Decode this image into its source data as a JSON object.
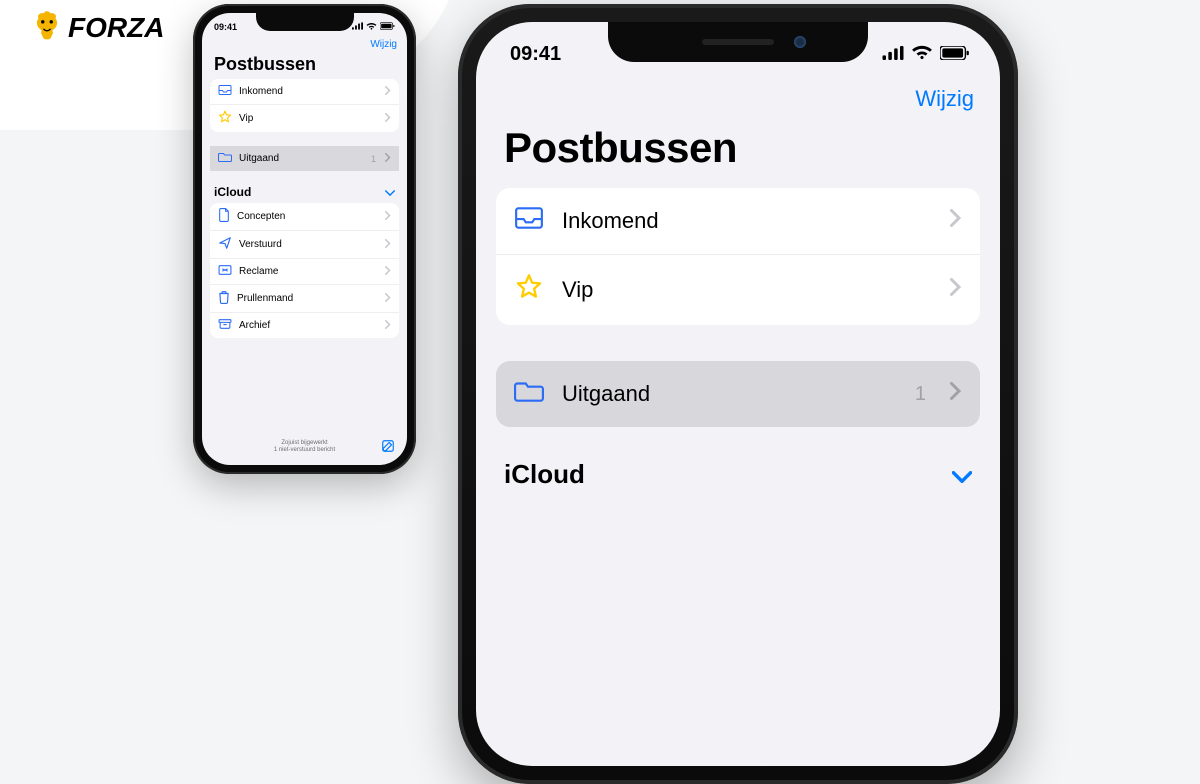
{
  "brand": {
    "name": "FORZA"
  },
  "statusbar": {
    "time": "09:41"
  },
  "nav": {
    "edit": "Wijzig"
  },
  "title": "Postbussen",
  "mailboxes": {
    "inbox": {
      "label": "Inkomend"
    },
    "vip": {
      "label": "Vip"
    }
  },
  "outbox": {
    "label": "Uitgaand",
    "count": "1"
  },
  "account": {
    "name": "iCloud"
  },
  "account_folders": {
    "drafts": {
      "label": "Concepten"
    },
    "sent": {
      "label": "Verstuurd"
    },
    "junk": {
      "label": "Reclame"
    },
    "trash": {
      "label": "Prullenmand"
    },
    "archive": {
      "label": "Archief"
    }
  },
  "footer": {
    "line1": "Zojuist bijgewerkt",
    "line2": "1 niet-verstuurd bericht"
  },
  "colors": {
    "accent": "#007aff",
    "star": "#ffcc00",
    "screenBg": "#f2f2f7",
    "selectedRow": "#d7d7dc",
    "secondaryText": "#a1a1a6"
  }
}
